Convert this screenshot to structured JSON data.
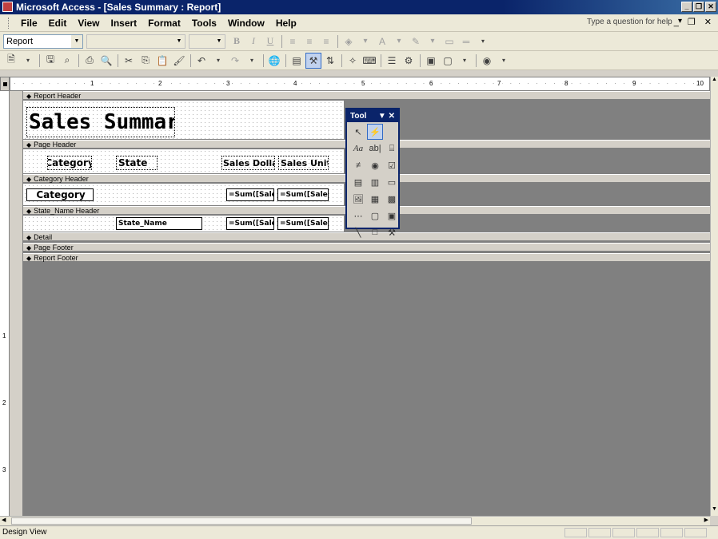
{
  "window": {
    "title": "Microsoft Access - [Sales Summary : Report]"
  },
  "menu": {
    "items": [
      "File",
      "Edit",
      "View",
      "Insert",
      "Format",
      "Tools",
      "Window",
      "Help"
    ],
    "help_placeholder": "Type a question for help"
  },
  "formatting_toolbar": {
    "object_combo": "Report",
    "bold": "B",
    "italic": "I",
    "underline": "U",
    "font_color": "A"
  },
  "ruler": {
    "marks": [
      "1",
      "2",
      "3",
      "4",
      "5",
      "6",
      "7",
      "8",
      "9",
      "10"
    ]
  },
  "vruler": {
    "marks": [
      "1",
      "2",
      "3"
    ]
  },
  "sections": {
    "report_header": "Report Header",
    "page_header": "Page Header",
    "category_header": "Category Header",
    "state_header": "State_Name Header",
    "detail": "Detail",
    "page_footer": "Page Footer",
    "report_footer": "Report Footer"
  },
  "controls": {
    "title": "Sales Summary",
    "hdr_category": "Category",
    "hdr_state": "State",
    "hdr_sales_dollars": "Sales Dollars",
    "hdr_sales_units": "Sales Units",
    "cat_category": "Category",
    "cat_sum_dollars": "=Sum([Sale:",
    "cat_sum_units": "=Sum([Sales",
    "st_state_name": "State_Name",
    "st_sum_dollars": "=Sum([Sale:",
    "st_sum_units": "=Sum([Sales"
  },
  "toolbox": {
    "title": "Tool"
  },
  "status": {
    "text": "Design View"
  }
}
